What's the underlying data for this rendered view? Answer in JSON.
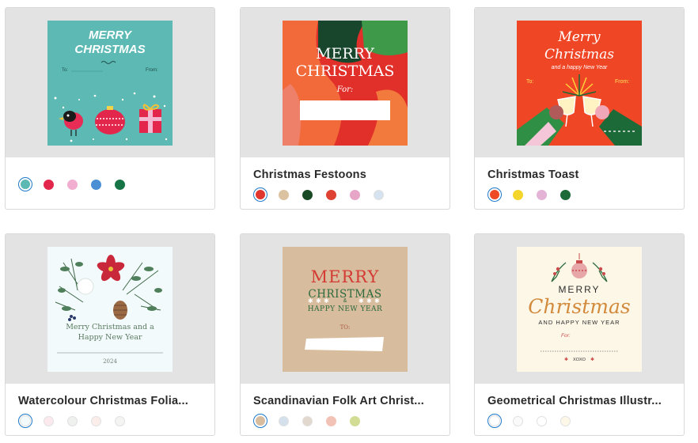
{
  "cards": [
    {
      "title": "",
      "colors": [
        "#5bb8b2",
        "#e3264b",
        "#f2aed0",
        "#4a8fd3",
        "#167447"
      ],
      "selected": 0,
      "tag": {
        "line1": "MERRY",
        "line2": "CHRISTMAS",
        "to": "To:",
        "from": "From:"
      }
    },
    {
      "title": "Christmas Festoons",
      "colors": [
        "#e0362d",
        "#dbc3a1",
        "#1a4a25",
        "#dd4232",
        "#e7a6c8",
        "#d5e2ef"
      ],
      "selected": 0,
      "tag": {
        "line1": "MERRY",
        "line2": "CHRISTMAS",
        "for": "For:"
      }
    },
    {
      "title": "Christmas Toast",
      "colors": [
        "#ef4a26",
        "#f4d52b",
        "#e3b4d6",
        "#1b6a37"
      ],
      "selected": 0,
      "tag": {
        "line1": "Merry",
        "line2": "Christmas",
        "line3": "and a happy New Year",
        "to": "To:",
        "from": "From:"
      }
    },
    {
      "title": "Watercolour Christmas Folia...",
      "colors": [
        "#f3fafb",
        "#fbe9ee",
        "#eef1ee",
        "#fbeeea",
        "#f4f4f2"
      ],
      "selected": 0,
      "tag": {
        "line1": "Merry Christmas and a",
        "line2": "Happy New Year",
        "year": "2024"
      }
    },
    {
      "title": "Scandinavian Folk Art Christ...",
      "colors": [
        "#d8bc9e",
        "#d4e0ec",
        "#e2d8ce",
        "#f2c2b6",
        "#d3dc94"
      ],
      "selected": 0,
      "tag": {
        "line1": "MERRY",
        "line2": "CHRISTMAS",
        "amp": "&",
        "line3": "HAPPY NEW YEAR",
        "to": "TO:"
      }
    },
    {
      "title": "Geometrical Christmas Illustr...",
      "colors": [
        "#ffffff",
        "#fafafa",
        "#ffffff",
        "#fdf7e7"
      ],
      "selected": 0,
      "tag": {
        "line1": "MERRY",
        "line2": "Christmas",
        "line3": "AND HAPPY NEW YEAR",
        "for": "For:",
        "sign": "XOXO"
      }
    }
  ]
}
